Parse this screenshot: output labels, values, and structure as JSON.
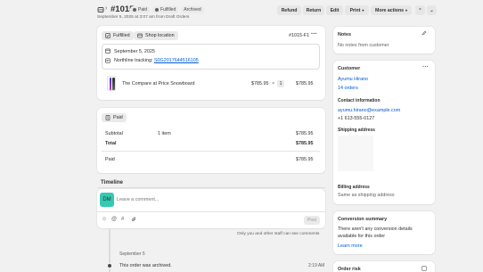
{
  "header": {
    "order_number": "#1015",
    "badges": {
      "paid": "Paid",
      "fulfilled": "Fulfilled",
      "archived": "Archived"
    },
    "subtitle": "September 5, 2025 at 3:07 am from Draft Orders",
    "buttons": {
      "refund": "Refund",
      "return": "Return",
      "edit": "Edit",
      "print": "Print",
      "more_actions": "More actions"
    }
  },
  "fulfillment": {
    "status": "Fulfilled",
    "location_button": "Shop location",
    "fulfillment_id": "#1015-F1",
    "date": "September 5, 2025",
    "tracking_label": "Northline tracking:",
    "tracking_number": "S0G2017644516105",
    "item": {
      "name": "The Compare at Price Snowboard",
      "price": "$785.95",
      "times": "×",
      "qty": "1",
      "total": "$785.95"
    }
  },
  "payment": {
    "status": "Paid",
    "subtotal_label": "Subtotal",
    "subtotal_items": "1 item",
    "subtotal_value": "$785.95",
    "total_label": "Total",
    "total_value": "$785.95",
    "paid_label": "Paid",
    "paid_value": "$785.95"
  },
  "timeline": {
    "title": "Timeline",
    "avatar_initials": "DM",
    "comment_placeholder": "Leave a comment...",
    "post_button": "Post",
    "staff_note": "Only you and other staff can see comments",
    "date_header": "September 5",
    "event_text": "This order was archived.",
    "event_time": "2:19 AM"
  },
  "notes": {
    "title": "Notes",
    "body": "No notes from customer"
  },
  "customer": {
    "title": "Customer",
    "name": "Ayumu Hirano",
    "orders": "14 orders",
    "contact_title": "Contact information",
    "email": "ayumu.hirano@example.com",
    "phone": "+1 613-555-0127",
    "shipping_title": "Shipping address",
    "billing_title": "Billing address",
    "billing_body": "Same as shipping address"
  },
  "conversion": {
    "title": "Conversion summary",
    "body": "There aren't any conversion details available for this order",
    "link": "Learn more"
  },
  "risk": {
    "title": "Order risk"
  },
  "colors": {
    "accent_link": "#005bd3",
    "background": "#f1f1f1",
    "card": "#ffffff"
  }
}
